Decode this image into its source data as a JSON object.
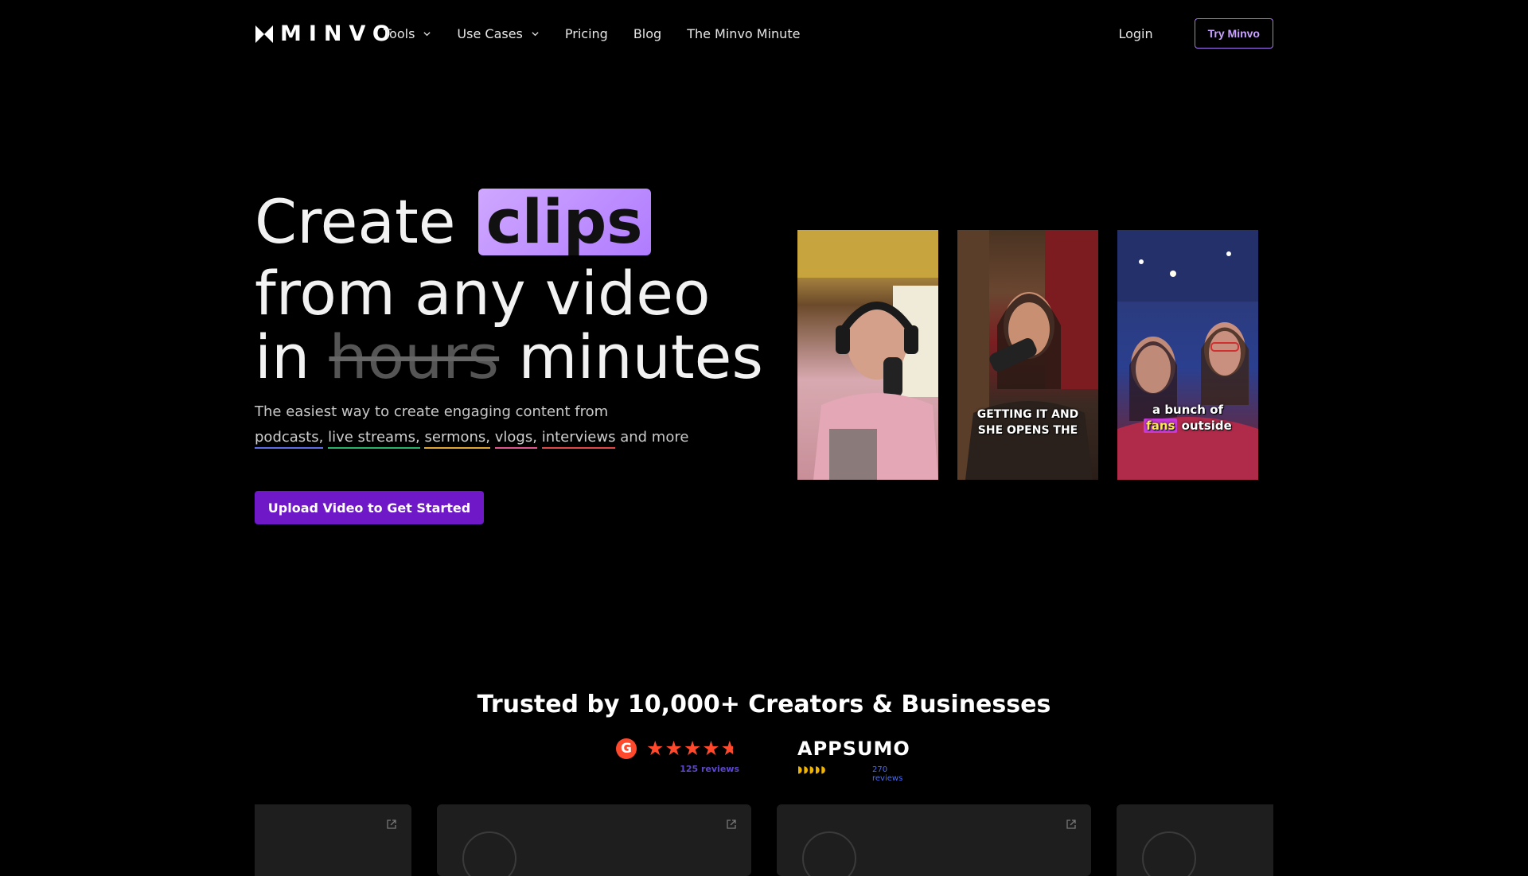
{
  "nav": {
    "logo_text": "MINVO",
    "items": [
      {
        "label": "Tools",
        "has_dropdown": true
      },
      {
        "label": "Use Cases",
        "has_dropdown": true
      },
      {
        "label": "Pricing",
        "has_dropdown": false
      },
      {
        "label": "Blog",
        "has_dropdown": false
      },
      {
        "label": "The Minvo Minute",
        "has_dropdown": false
      }
    ],
    "login_label": "Login",
    "try_label": "Try Minvo"
  },
  "hero": {
    "title_create": "Create",
    "title_clips": "clips",
    "title_line2": "from any video",
    "title_in": "in",
    "title_hours": "hours",
    "title_minutes": "minutes",
    "subtitle": "The easiest way to create engaging content from",
    "tags": [
      "podcasts,",
      "live streams,",
      "sermons,",
      "vlogs,",
      "interviews"
    ],
    "tags_suffix": "and more",
    "cta_label": "Upload Video to Get Started"
  },
  "clips": [
    {
      "caption": ""
    },
    {
      "caption_line1": "GETTING IT AND",
      "caption_line2": "SHE OPENS THE"
    },
    {
      "caption_line1": "a bunch of",
      "caption_highlight": "fans",
      "caption_rest": "outside"
    }
  ],
  "trust": {
    "title": "Trusted by 10,000+ Creators & Businesses",
    "g2": {
      "logo": "G2",
      "rating": 4.5,
      "reviews": "125 reviews"
    },
    "appsumo": {
      "logo": "APPSUMO",
      "rating": 5,
      "reviews": "270 reviews"
    }
  },
  "colors": {
    "accent": "#6e18c7",
    "highlight": "#c9a3ff",
    "background": "#000000",
    "card": "#1e1e1e",
    "g2_red": "#ff492c"
  }
}
